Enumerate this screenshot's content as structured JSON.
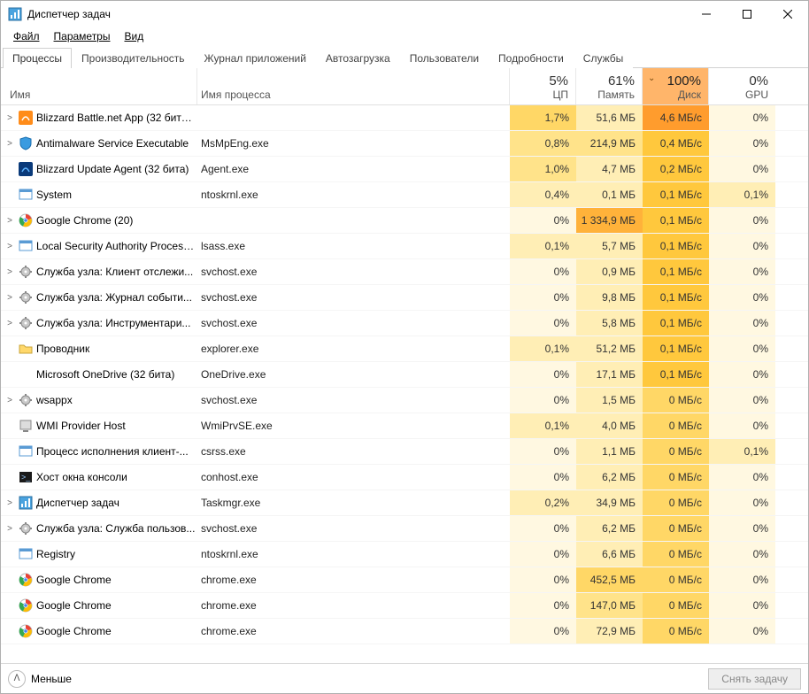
{
  "window": {
    "title": "Диспетчер задач"
  },
  "menu": {
    "file": "Файл",
    "options": "Параметры",
    "view": "Вид"
  },
  "tabs": {
    "processes": "Процессы",
    "performance": "Производительность",
    "apphistory": "Журнал приложений",
    "startup": "Автозагрузка",
    "users": "Пользователи",
    "details": "Подробности",
    "services": "Службы"
  },
  "columns": {
    "name": "Имя",
    "procname": "Имя процесса",
    "cpu": {
      "pct": "5%",
      "label": "ЦП"
    },
    "mem": {
      "pct": "61%",
      "label": "Память"
    },
    "disk": {
      "pct": "100%",
      "label": "Диск"
    },
    "gpu": {
      "pct": "0%",
      "label": "GPU"
    }
  },
  "footer": {
    "less": "Меньше",
    "endtask": "Снять задачу"
  },
  "rows": [
    {
      "exp": ">",
      "icon": "blizzard-orange",
      "name": "Blizzard Battle.net App (32 бита)...",
      "exe": "",
      "cpu": "1,7%",
      "cpu_h": 3,
      "mem": "51,6 МБ",
      "mem_h": 1,
      "disk": "4,6 МБ/с",
      "disk_h": 6,
      "gpu": "0%",
      "gpu_h": 0
    },
    {
      "exp": ">",
      "icon": "shield",
      "name": "Antimalware Service Executable",
      "exe": "MsMpEng.exe",
      "cpu": "0,8%",
      "cpu_h": 2,
      "mem": "214,9 МБ",
      "mem_h": 2,
      "disk": "0,4 МБ/с",
      "disk_h": 4,
      "gpu": "0%",
      "gpu_h": 0
    },
    {
      "exp": "",
      "icon": "blizzard-blue",
      "name": "Blizzard Update Agent (32 бита)",
      "exe": "Agent.exe",
      "cpu": "1,0%",
      "cpu_h": 2,
      "mem": "4,7 МБ",
      "mem_h": 1,
      "disk": "0,2 МБ/с",
      "disk_h": 4,
      "gpu": "0%",
      "gpu_h": 0
    },
    {
      "exp": "",
      "icon": "app",
      "name": "System",
      "exe": "ntoskrnl.exe",
      "cpu": "0,4%",
      "cpu_h": 1,
      "mem": "0,1 МБ",
      "mem_h": 1,
      "disk": "0,1 МБ/с",
      "disk_h": 4,
      "gpu": "0,1%",
      "gpu_h": 1
    },
    {
      "exp": ">",
      "icon": "chrome",
      "name": "Google Chrome (20)",
      "exe": "",
      "cpu": "0%",
      "cpu_h": 0,
      "mem": "1 334,9 МБ",
      "mem_h": 5,
      "disk": "0,1 МБ/с",
      "disk_h": 4,
      "gpu": "0%",
      "gpu_h": 0
    },
    {
      "exp": ">",
      "icon": "app",
      "name": "Local Security Authority Process...",
      "exe": "lsass.exe",
      "cpu": "0,1%",
      "cpu_h": 1,
      "mem": "5,7 МБ",
      "mem_h": 1,
      "disk": "0,1 МБ/с",
      "disk_h": 4,
      "gpu": "0%",
      "gpu_h": 0
    },
    {
      "exp": ">",
      "icon": "gear",
      "name": "Служба узла: Клиент отслежи...",
      "exe": "svchost.exe",
      "cpu": "0%",
      "cpu_h": 0,
      "mem": "0,9 МБ",
      "mem_h": 1,
      "disk": "0,1 МБ/с",
      "disk_h": 4,
      "gpu": "0%",
      "gpu_h": 0
    },
    {
      "exp": ">",
      "icon": "gear",
      "name": "Служба узла: Журнал событи...",
      "exe": "svchost.exe",
      "cpu": "0%",
      "cpu_h": 0,
      "mem": "9,8 МБ",
      "mem_h": 1,
      "disk": "0,1 МБ/с",
      "disk_h": 4,
      "gpu": "0%",
      "gpu_h": 0
    },
    {
      "exp": ">",
      "icon": "gear",
      "name": "Служба узла: Инструментари...",
      "exe": "svchost.exe",
      "cpu": "0%",
      "cpu_h": 0,
      "mem": "5,8 МБ",
      "mem_h": 1,
      "disk": "0,1 МБ/с",
      "disk_h": 4,
      "gpu": "0%",
      "gpu_h": 0
    },
    {
      "exp": "",
      "icon": "folder",
      "name": "Проводник",
      "exe": "explorer.exe",
      "cpu": "0,1%",
      "cpu_h": 1,
      "mem": "51,2 МБ",
      "mem_h": 1,
      "disk": "0,1 МБ/с",
      "disk_h": 4,
      "gpu": "0%",
      "gpu_h": 0
    },
    {
      "exp": "",
      "icon": "none",
      "name": "Microsoft OneDrive (32 бита)",
      "exe": "OneDrive.exe",
      "cpu": "0%",
      "cpu_h": 0,
      "mem": "17,1 МБ",
      "mem_h": 1,
      "disk": "0,1 МБ/с",
      "disk_h": 4,
      "gpu": "0%",
      "gpu_h": 0
    },
    {
      "exp": ">",
      "icon": "gear",
      "name": "wsappx",
      "exe": "svchost.exe",
      "cpu": "0%",
      "cpu_h": 0,
      "mem": "1,5 МБ",
      "mem_h": 1,
      "disk": "0 МБ/с",
      "disk_h": 3,
      "gpu": "0%",
      "gpu_h": 0
    },
    {
      "exp": "",
      "icon": "wmi",
      "name": "WMI Provider Host",
      "exe": "WmiPrvSE.exe",
      "cpu": "0,1%",
      "cpu_h": 1,
      "mem": "4,0 МБ",
      "mem_h": 1,
      "disk": "0 МБ/с",
      "disk_h": 3,
      "gpu": "0%",
      "gpu_h": 0
    },
    {
      "exp": "",
      "icon": "app",
      "name": "Процесс исполнения клиент-...",
      "exe": "csrss.exe",
      "cpu": "0%",
      "cpu_h": 0,
      "mem": "1,1 МБ",
      "mem_h": 1,
      "disk": "0 МБ/с",
      "disk_h": 3,
      "gpu": "0,1%",
      "gpu_h": 1
    },
    {
      "exp": "",
      "icon": "console",
      "name": "Хост окна консоли",
      "exe": "conhost.exe",
      "cpu": "0%",
      "cpu_h": 0,
      "mem": "6,2 МБ",
      "mem_h": 1,
      "disk": "0 МБ/с",
      "disk_h": 3,
      "gpu": "0%",
      "gpu_h": 0
    },
    {
      "exp": ">",
      "icon": "taskmgr",
      "name": "Диспетчер задач",
      "exe": "Taskmgr.exe",
      "cpu": "0,2%",
      "cpu_h": 1,
      "mem": "34,9 МБ",
      "mem_h": 1,
      "disk": "0 МБ/с",
      "disk_h": 3,
      "gpu": "0%",
      "gpu_h": 0
    },
    {
      "exp": ">",
      "icon": "gear",
      "name": "Служба узла: Служба пользов...",
      "exe": "svchost.exe",
      "cpu": "0%",
      "cpu_h": 0,
      "mem": "6,2 МБ",
      "mem_h": 1,
      "disk": "0 МБ/с",
      "disk_h": 3,
      "gpu": "0%",
      "gpu_h": 0
    },
    {
      "exp": "",
      "icon": "app",
      "name": "Registry",
      "exe": "ntoskrnl.exe",
      "cpu": "0%",
      "cpu_h": 0,
      "mem": "6,6 МБ",
      "mem_h": 1,
      "disk": "0 МБ/с",
      "disk_h": 3,
      "gpu": "0%",
      "gpu_h": 0
    },
    {
      "exp": "",
      "icon": "chrome",
      "name": "Google Chrome",
      "exe": "chrome.exe",
      "cpu": "0%",
      "cpu_h": 0,
      "mem": "452,5 МБ",
      "mem_h": 3,
      "disk": "0 МБ/с",
      "disk_h": 3,
      "gpu": "0%",
      "gpu_h": 0
    },
    {
      "exp": "",
      "icon": "chrome",
      "name": "Google Chrome",
      "exe": "chrome.exe",
      "cpu": "0%",
      "cpu_h": 0,
      "mem": "147,0 МБ",
      "mem_h": 2,
      "disk": "0 МБ/с",
      "disk_h": 3,
      "gpu": "0%",
      "gpu_h": 0
    },
    {
      "exp": "",
      "icon": "chrome",
      "name": "Google Chrome",
      "exe": "chrome.exe",
      "cpu": "0%",
      "cpu_h": 0,
      "mem": "72,9 МБ",
      "mem_h": 1,
      "disk": "0 МБ/с",
      "disk_h": 3,
      "gpu": "0%",
      "gpu_h": 0
    }
  ]
}
